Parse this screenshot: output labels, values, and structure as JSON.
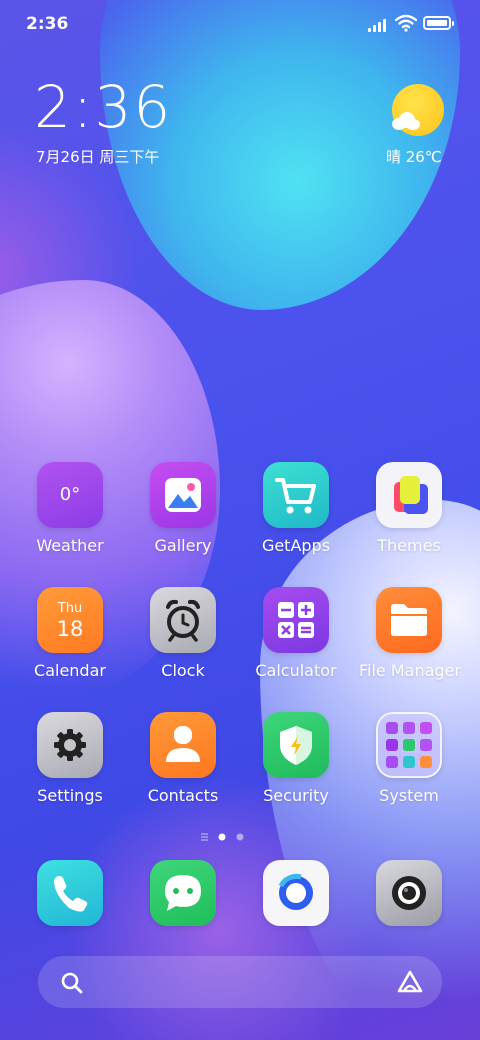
{
  "status_bar": {
    "time": "2:36"
  },
  "clock_widget": {
    "time": "2:36",
    "date": "7月26日 周三下午"
  },
  "weather_widget": {
    "text": "晴 26℃"
  },
  "apps": [
    {
      "label": "Weather",
      "badge": "0°"
    },
    {
      "label": "Gallery"
    },
    {
      "label": "GetApps"
    },
    {
      "label": "Themes"
    },
    {
      "label": "Calendar",
      "day": "Thu",
      "date": "18"
    },
    {
      "label": "Clock"
    },
    {
      "label": "Calculator"
    },
    {
      "label": "File Manager"
    },
    {
      "label": "Settings"
    },
    {
      "label": "Contacts"
    },
    {
      "label": "Security"
    },
    {
      "label": "System"
    }
  ],
  "dock": [
    {
      "name": "Phone",
      "icon": "phone-icon"
    },
    {
      "name": "Messaging",
      "icon": "message-icon"
    },
    {
      "name": "Browser",
      "icon": "browser-icon"
    },
    {
      "name": "Camera",
      "icon": "camera-icon"
    }
  ],
  "page_indicator": {
    "pages": 2,
    "current": 1
  }
}
